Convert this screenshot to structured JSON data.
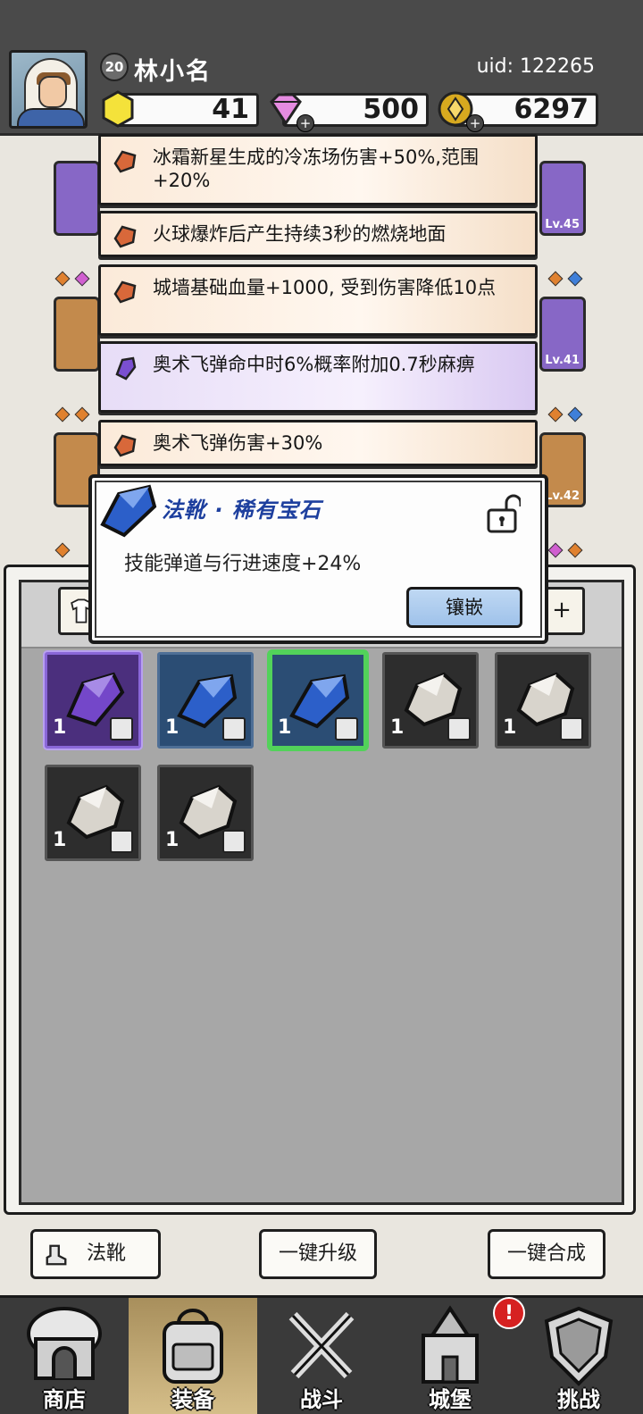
{
  "player": {
    "level": "20",
    "name": "林小名",
    "uid": "uid: 122265"
  },
  "resources": {
    "energy": "41",
    "gems": "500",
    "coins": "6297",
    "plus": "+"
  },
  "slot_levels": [
    "Lv.45",
    "Lv.41",
    "Lv.42"
  ],
  "affixes": [
    {
      "text": "冰霜新星生成的冷冻场伤害+50%,范围+20%",
      "gem_color": "orange"
    },
    {
      "text": "火球爆炸后产生持续3秒的燃烧地面",
      "gem_color": "orange"
    },
    {
      "text": "城墙基础血量+1000, 受到伤害降低10点",
      "gem_color": "orange"
    },
    {
      "text": "奥术飞弹命中时6%概率附加0.7秒麻痹",
      "gem_color": "purple"
    },
    {
      "text": "奥术飞弹伤害+30%",
      "gem_color": "orange"
    }
  ],
  "popup": {
    "title": "法靴 · 稀有宝石",
    "description": "技能弹道与行进速度+24%",
    "inlay_button": "镶嵌"
  },
  "inventory": {
    "filter_add": "+",
    "items": [
      {
        "type": "purple",
        "qty": "1"
      },
      {
        "type": "blue",
        "qty": "1"
      },
      {
        "type": "blue",
        "qty": "1",
        "selected": true
      },
      {
        "type": "white",
        "qty": "1"
      },
      {
        "type": "white",
        "qty": "1"
      },
      {
        "type": "white",
        "qty": "1"
      },
      {
        "type": "white",
        "qty": "1"
      }
    ]
  },
  "actions": {
    "category": "法靴",
    "upgrade_all": "一键升级",
    "merge_all": "一键合成"
  },
  "nav": {
    "items": [
      {
        "label": "商店",
        "icon": "shop-icon"
      },
      {
        "label": "装备",
        "icon": "backpack-icon"
      },
      {
        "label": "战斗",
        "icon": "crossed-swords-icon"
      },
      {
        "label": "城堡",
        "icon": "castle-icon"
      },
      {
        "label": "挑战",
        "icon": "shield-icon"
      }
    ],
    "alert": "!"
  },
  "colors": {
    "topbar": "#4a4a4a",
    "rare_title": "#1d3f9e",
    "selected_outline": "#52d25a",
    "alert": "#d62121"
  }
}
